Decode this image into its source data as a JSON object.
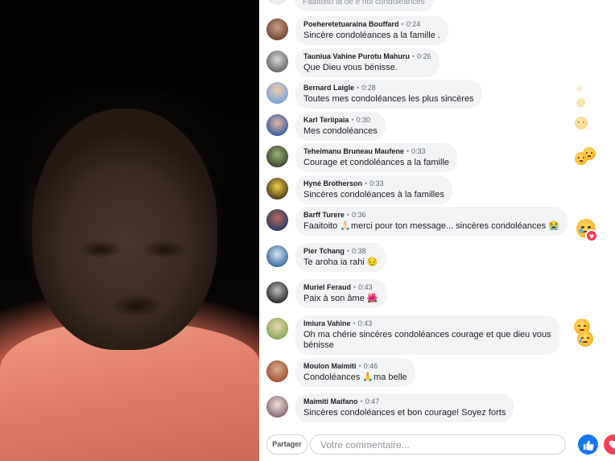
{
  "top_partial_comment": "Faaitoito ia oe e hoi condoléances",
  "comments": [
    {
      "name": "Poeheretetuaraina Bouffard",
      "time": "0:24",
      "text": "Sincère condoléances a la famille .",
      "emoji": ""
    },
    {
      "name": "Tauniua Vahine Purotu Mahuru",
      "time": "0:26",
      "text": "Que Dieu vous bénisse.",
      "emoji": ""
    },
    {
      "name": "Bernard Laigle",
      "time": "0:28",
      "text": "Toutes mes condoléances les plus sincères",
      "emoji": ""
    },
    {
      "name": "Karl Teriipaia",
      "time": "0:30",
      "text": "Mes condoléances",
      "emoji": ""
    },
    {
      "name": "Teheimanu Bruneau Maufene",
      "time": "0:33",
      "text": "Courage et condoléances a la famille",
      "emoji": ""
    },
    {
      "name": "Hyné Brotherson",
      "time": "0:33",
      "text": "Sincères condoléances à la familles",
      "emoji": ""
    },
    {
      "name": "Barff Turere",
      "time": "0:36",
      "text": "Faaitoito 🙏🏻merci pour ton message... sincères condoléances 😭",
      "emoji": ""
    },
    {
      "name": "Pier Tchang",
      "time": "0:38",
      "text": "Te aroha ia rahi 😔",
      "emoji": ""
    },
    {
      "name": "Muriel Feraud",
      "time": "0:43",
      "text": "Paix à son âme 🌺",
      "emoji": ""
    },
    {
      "name": "Imiura Vahine",
      "time": "0:43",
      "text": "Oh ma chérie sincères condoléances courage et que dieu vous\nbénisse",
      "emoji": ""
    },
    {
      "name": "Moulon Maimiti",
      "time": "0:46",
      "text": "Condoléances 🙏ma belle",
      "emoji": ""
    },
    {
      "name": "Maimiti Maifano",
      "time": "0:47",
      "text": "Sincères condoléances et bon courage! Soyez forts",
      "emoji": ""
    }
  ],
  "bottom": {
    "share_label": "Partager",
    "comment_placeholder": "Votre commentaire..."
  },
  "icons": {
    "like": "thumbs-up-icon",
    "love": "heart-icon"
  },
  "colors": {
    "accent": "#1877f2",
    "love": "#f33e58",
    "bubble": "#f2f3f5",
    "video_shirt": "#e0806b"
  }
}
